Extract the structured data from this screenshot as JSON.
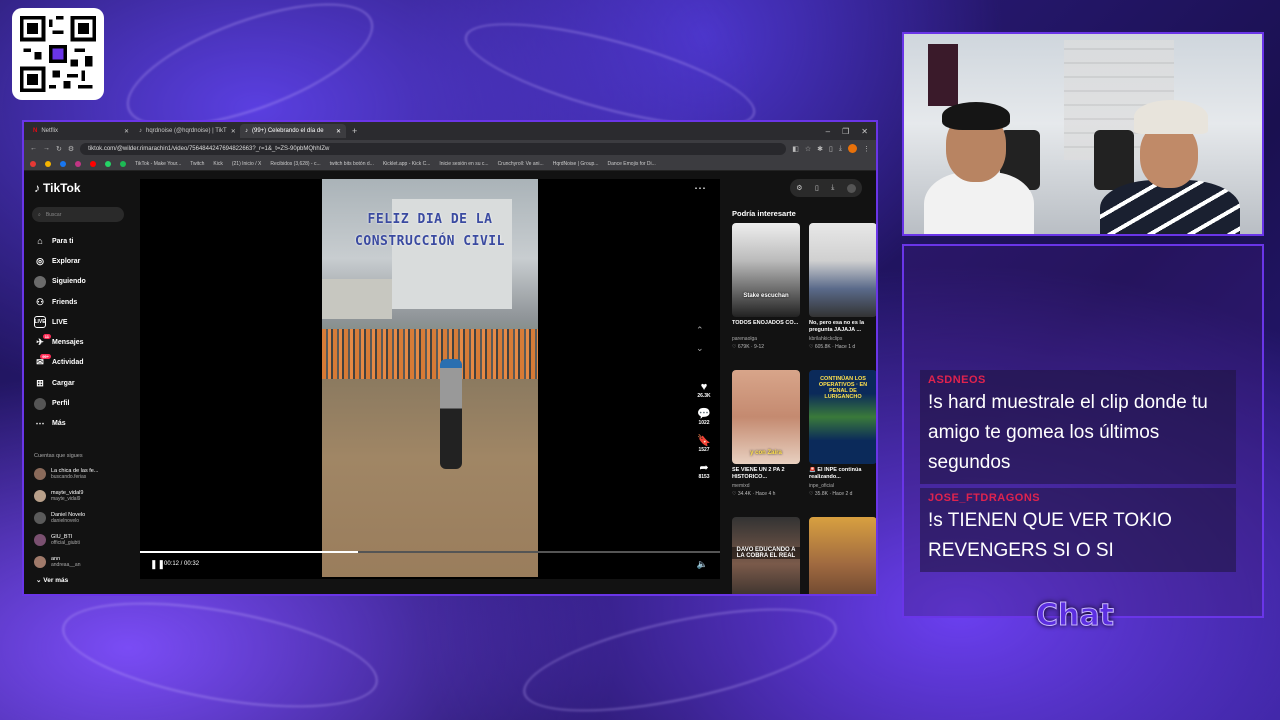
{
  "colors": {
    "accent": "#6a35e8",
    "tiktok_red": "#fe2c55",
    "chat_username": "#e0234e"
  },
  "browser": {
    "tabs": [
      {
        "label": "Netflix",
        "icon": "netflix-icon",
        "active": false
      },
      {
        "label": "hqrdnoise (@hqrdnoise) | TikT",
        "icon": "tiktok-icon",
        "active": false
      },
      {
        "label": "(99+) Celebrando el día de",
        "icon": "tiktok-icon",
        "active": true
      }
    ],
    "url": "tiktok.com/@wilder.rimarachin1/video/7564844247694822663?_r=1&_t=ZS-90pbMQhhIZw",
    "bookmarks": [
      "TikTok - Make Your...",
      "Twitch",
      "Kick",
      "(21) Inicio / X",
      "Recibidos (3,628) - c...",
      "twitch bits botón d...",
      "Kicklet.app - Kick C...",
      "Inicie sesión en su c...",
      "Crunchyroll: Ve ani...",
      "HqrdNoise | Group...",
      "Dance Emojis for Di..."
    ]
  },
  "tiktok": {
    "logo": "TikTok",
    "search_placeholder": "Buscar",
    "nav": [
      {
        "label": "Para ti",
        "icon": "home-icon"
      },
      {
        "label": "Explorar",
        "icon": "compass-icon"
      },
      {
        "label": "Siguiendo",
        "icon": "following-icon"
      },
      {
        "label": "Friends",
        "icon": "friends-icon"
      },
      {
        "label": "LIVE",
        "icon": "live-icon"
      },
      {
        "label": "Mensajes",
        "icon": "messages-icon",
        "badge": "11"
      },
      {
        "label": "Actividad",
        "icon": "activity-icon",
        "badge": "99+"
      },
      {
        "label": "Cargar",
        "icon": "upload-icon"
      },
      {
        "label": "Perfil",
        "icon": "profile-icon"
      },
      {
        "label": "Más",
        "icon": "more-icon"
      }
    ],
    "following_header": "Cuentas que sigues",
    "following": [
      {
        "name": "La chica de las fe...",
        "handle": "buscando.ferias"
      },
      {
        "name": "mayte_vidal9",
        "handle": "mayte_vidal9"
      },
      {
        "name": "Daniel Novelo",
        "handle": "danielnovelo"
      },
      {
        "name": "GIU_BTI",
        "handle": "official_giubti"
      },
      {
        "name": "ann",
        "handle": "andreaa__an"
      }
    ],
    "see_more": "Ver más",
    "video": {
      "caption_line1": "FELIZ DIA DE LA",
      "caption_line2": "CONSTRUCCIÓN CIVIL",
      "time": "00:12 / 00:32",
      "progress": 0.375
    },
    "actions": [
      {
        "icon": "heart-icon",
        "count": "26.3K"
      },
      {
        "icon": "comment-icon",
        "count": "1022"
      },
      {
        "icon": "bookmark-icon",
        "count": "1527"
      },
      {
        "icon": "share-icon",
        "count": "8153"
      }
    ],
    "suggestions_header": "Podría interesarte",
    "suggestions": [
      {
        "title": "TODOS ENOJADOS CO...",
        "author": "parenaolga",
        "meta": "♡ 679K · 9-12",
        "thumb_text": "Stake escuchan"
      },
      {
        "title": "No, pero esa no es la pregunta JAJAJA ...",
        "author": "kbrilahkickclips",
        "meta": "♡ 605.8K · Hace 1 d",
        "thumb_text": ""
      },
      {
        "title": "SE VIENE UN 2 PA 2 HISTORICO...",
        "author": "memixd",
        "meta": "♡ 34.4K · Hace 4 h",
        "thumb_text": "y con Zaira"
      },
      {
        "title": "🚨 El INPE continúa realizando...",
        "author": "inpe_oficial",
        "meta": "♡ 35.8K · Hace 2 d",
        "thumb_text": "CONTINÚAN LOS OPERATIVOS · EN PENAL DE LURIGANCHO"
      },
      {
        "title": "",
        "author": "",
        "meta": "",
        "thumb_text": "DAVO EDUCANDO A LA COBRA EL REAL"
      },
      {
        "title": "",
        "author": "",
        "meta": "",
        "thumb_text": ""
      }
    ]
  },
  "chat": {
    "label": "Chat",
    "messages": [
      {
        "user": "ASDNEOS",
        "text": "!s hard muestrale el clip donde tu amigo te gomea los últimos segundos"
      },
      {
        "user": "JOSE_FTDRAGONS",
        "text": "!s TIENEN QUE VER TOKIO REVENGERS SI O SI"
      }
    ]
  }
}
